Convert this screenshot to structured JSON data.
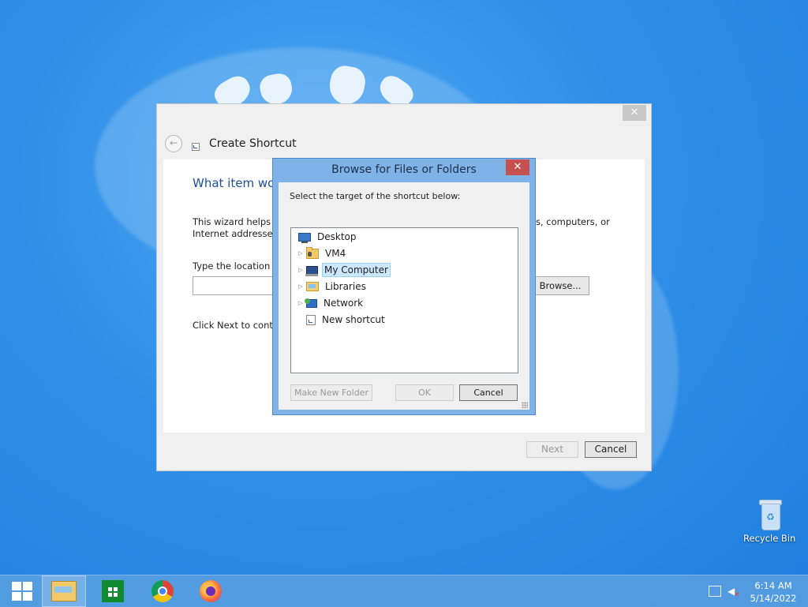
{
  "wizard": {
    "title": "Create Shortcut",
    "close_glyph": "✕",
    "back_glyph": "←",
    "question": "What item wou",
    "intro": "This wizard helps y                                                                                          s, computers, or Internet addresses.",
    "intro_left_1": "This wizard helps y",
    "intro_right_1": "s, computers, or",
    "intro_line_2": "Internet addresses.",
    "location_label": "Type the location o",
    "location_value": "",
    "browse_label": "Browse...",
    "click_next_text": "Click Next to contin",
    "next_label": "Next",
    "cancel_label": "Cancel"
  },
  "browse_dialog": {
    "title": "Browse for Files or Folders",
    "close_glyph": "✕",
    "instruction": "Select the target of the shortcut below:",
    "tree": [
      {
        "label": "Desktop",
        "icon": "desktop-icon",
        "expandable": false,
        "selected": false,
        "level": 0
      },
      {
        "label": "VM4",
        "icon": "user-folder-icon",
        "expandable": true,
        "selected": false,
        "level": 1
      },
      {
        "label": "My Computer",
        "icon": "computer-icon",
        "expandable": true,
        "selected": true,
        "level": 1
      },
      {
        "label": "Libraries",
        "icon": "libraries-icon",
        "expandable": true,
        "selected": false,
        "level": 1
      },
      {
        "label": "Network",
        "icon": "network-icon",
        "expandable": true,
        "selected": false,
        "level": 1
      },
      {
        "label": "New shortcut",
        "icon": "shortcut-icon",
        "expandable": false,
        "selected": false,
        "level": 1
      }
    ],
    "expander_glyph": "▷",
    "make_new_folder_label": "Make New Folder",
    "ok_label": "OK",
    "cancel_label": "Cancel"
  },
  "desktop": {
    "recycle_bin_label": "Recycle Bin"
  },
  "taskbar": {
    "apps": [
      "start-button",
      "file-explorer",
      "store",
      "chrome",
      "firefox"
    ],
    "active_app": "file-explorer",
    "clock_time": "6:14 AM",
    "clock_date": "5/14/2022"
  },
  "colors": {
    "desktop_bg": "#2f8fe8",
    "browse_frame": "#7fb2e6",
    "close_red": "#c75050",
    "heading_blue": "#1f4e99",
    "selection": "#cce8ff"
  }
}
